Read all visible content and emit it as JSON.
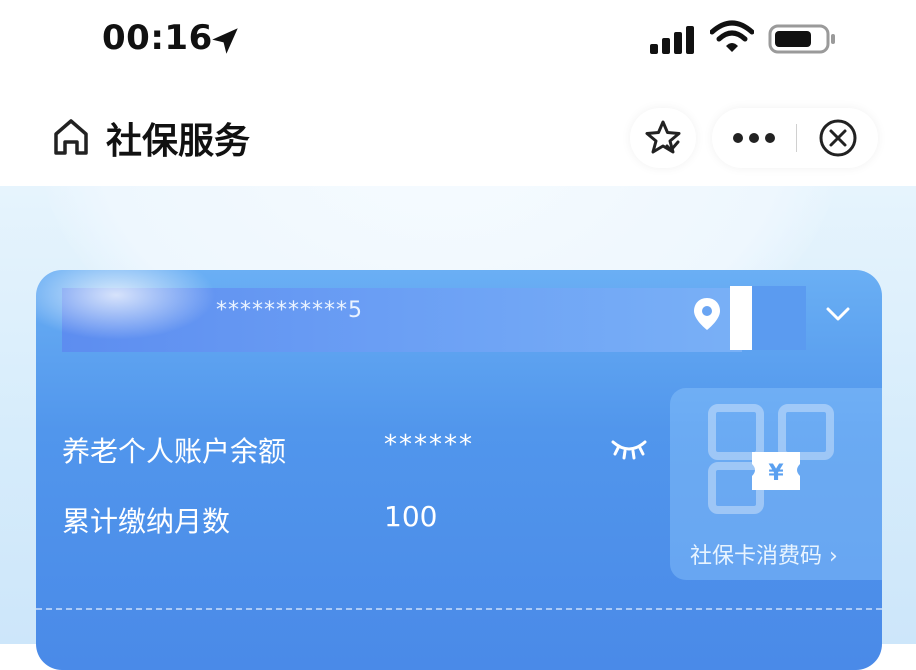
{
  "status_bar": {
    "time": "00:16",
    "icons": [
      "location-arrow-icon",
      "signal-icon",
      "wifi-icon",
      "battery-icon"
    ]
  },
  "nav": {
    "title": "社保服务",
    "icons": [
      "home-icon",
      "favorite-star-icon",
      "more-icon",
      "close-icon"
    ]
  },
  "card": {
    "number_masked": "***********5",
    "balance_label": "养老个人账户余额",
    "balance_value": "******",
    "months_label": "累计缴纳月数",
    "months_value": "100",
    "consume_code_label": "社保卡消费码 ›",
    "icons": [
      "location-pin-icon",
      "chevron-down-icon",
      "eye-closed-icon",
      "qr-code-icon",
      "yuan-ticket-icon"
    ]
  },
  "colors": {
    "card_top": "#6aaff4",
    "card_bottom": "#4a8ae8",
    "hero_background": "#e6f4fd"
  }
}
